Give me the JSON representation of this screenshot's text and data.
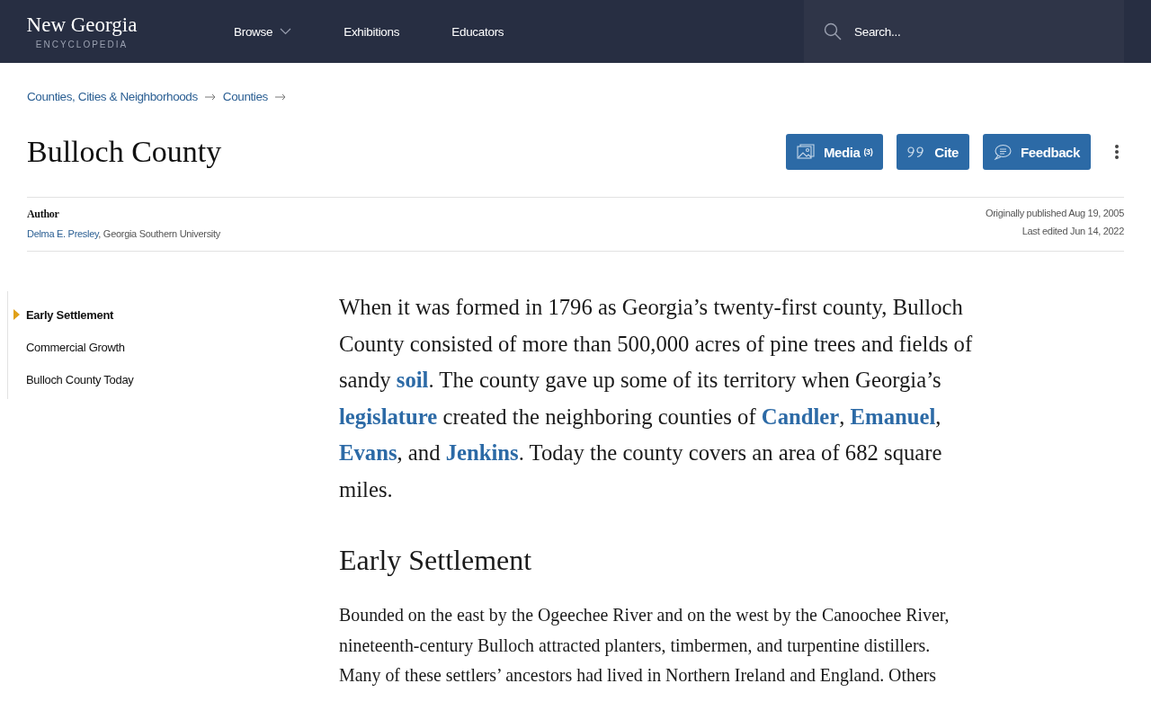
{
  "header": {
    "logo_title": "New Georgia",
    "logo_subtitle": "ENCYCLOPEDIA",
    "nav": [
      {
        "label": "Browse",
        "dropdown": true
      },
      {
        "label": "Exhibitions",
        "dropdown": false
      },
      {
        "label": "Educators",
        "dropdown": false
      }
    ],
    "search": {
      "placeholder": "Search..."
    }
  },
  "breadcrumbs": [
    "Counties, Cities & Neighborhoods",
    "Counties"
  ],
  "title": "Bulloch County",
  "actions": [
    {
      "kind": "media",
      "label": "Media",
      "count": "(3)"
    },
    {
      "kind": "cite",
      "label": "Cite"
    },
    {
      "kind": "feedback",
      "label": "Feedback"
    }
  ],
  "meta": {
    "author_label": "Author",
    "author_name": "Delma E. Presley",
    "author_affiliation": ", Georgia Southern University",
    "published": "Originally published Aug 19, 2005",
    "edited": "Last edited Jun 14, 2022"
  },
  "toc": [
    {
      "label": "Early Settlement",
      "selected": true
    },
    {
      "label": "Commercial Growth",
      "selected": false
    },
    {
      "label": "Bulloch County Today",
      "selected": false
    }
  ],
  "intro": [
    {
      "kind": "text",
      "text": "When it was formed in 1796 as Georgia’s twenty-first county, Bulloch County consisted of more than 500,000 acres of pine trees and fields of sandy "
    },
    {
      "kind": "link",
      "text": "soil"
    },
    {
      "kind": "text",
      "text": ". The county gave up some of its territory when Georgia’s "
    },
    {
      "kind": "link",
      "text": "legislature"
    },
    {
      "kind": "text",
      "text": " created the neighboring counties of "
    },
    {
      "kind": "link",
      "text": "Candler"
    },
    {
      "kind": "text",
      "text": ", "
    },
    {
      "kind": "link",
      "text": "Emanuel"
    },
    {
      "kind": "text",
      "text": ", "
    },
    {
      "kind": "link",
      "text": "Evans"
    },
    {
      "kind": "text",
      "text": ", and "
    },
    {
      "kind": "link",
      "text": "Jenkins"
    },
    {
      "kind": "text",
      "text": ". Today the county covers an area of 682 square miles."
    }
  ],
  "sections": [
    {
      "heading": "Early Settlement",
      "paragraph": "Bounded on the east by the Ogeechee River and on the west by the Canoochee River, nineteenth-century Bulloch attracted planters, timbermen, and turpentine distillers. Many of these settlers’ ancestors had lived in Northern Ireland and England. Others"
    }
  ]
}
